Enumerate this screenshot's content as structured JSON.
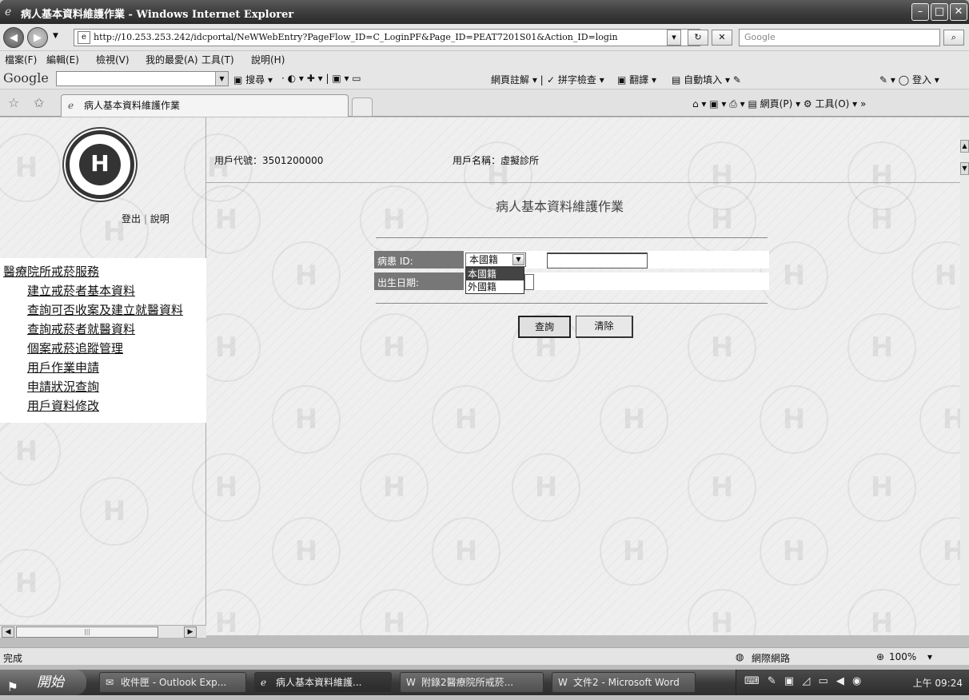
{
  "window": {
    "title": "病人基本資料維護作業 - Windows Internet Explorer"
  },
  "address": {
    "url": "http://10.253.253.242/idcportal/NeWWebEntry?PageFlow_ID=C_LoginPF&Page_ID=PEAT7201S01&Action_ID=login",
    "search_placeholder": "Google"
  },
  "menubar": {
    "items": [
      "檔案(F)",
      "編輯(E)",
      "檢視(V)",
      "我的最愛(A)",
      "工具(T)",
      "說明(H)"
    ]
  },
  "google_toolbar": {
    "logo": "Google",
    "search": "搜尋",
    "notes": "網頁註解",
    "spell": "拼字檢查",
    "translate": "翻譯",
    "autofill": "自動填入",
    "signin": "登入"
  },
  "tabs": {
    "active": "病人基本資料維護作業"
  },
  "command_bar": {
    "page": "網頁(P)",
    "tools": "工具(O)"
  },
  "sidebar": {
    "logout": "登出",
    "sep": "|",
    "help": "說明",
    "heading": "醫療院所戒菸服務",
    "items": [
      "建立戒菸者基本資料",
      "查詢可否收案及建立就醫資料",
      "查詢戒菸者就醫資料",
      "個案戒菸追蹤管理",
      "用戶作業申請",
      "申請狀況查詢",
      "用戶資料修改"
    ]
  },
  "header": {
    "user_id": "用戶代號：3501200000",
    "user_name": "用戶名稱：虛擬診所"
  },
  "main": {
    "title": "病人基本資料維護作業",
    "patient_id_label": "病患 ID:",
    "birth_label": "出生日期:",
    "nationality_selected": "本國籍",
    "nationality_options": [
      "本國籍",
      "外國籍"
    ],
    "query_button": "查詢",
    "clear_button": "清除"
  },
  "status": {
    "text": "完成",
    "zone": "網際網路",
    "zoom": "100%"
  },
  "taskbar": {
    "start": "開始",
    "tasks": [
      "收件匣 - Outlook Exp...",
      "病人基本資料維護...",
      "附錄2醫療院所戒菸...",
      "文件2 - Microsoft Word"
    ],
    "clock": "上午 09:24"
  },
  "colors": {
    "title_bar": "#3e3e3e",
    "menu_bg": "#ffffff",
    "label_bg": "#777777",
    "dropdown_highlight": "#444444"
  }
}
